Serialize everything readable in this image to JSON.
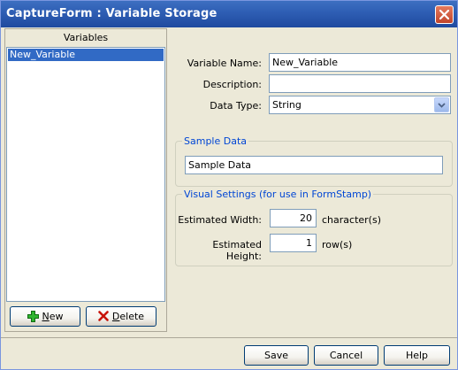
{
  "window": {
    "title": "CaptureForm : Variable Storage"
  },
  "variables_panel": {
    "header": "Variables",
    "items": [
      "New_Variable"
    ],
    "new_button": {
      "prefix": "",
      "mnemonic": "N",
      "suffix": "ew"
    },
    "delete_button": {
      "prefix": "",
      "mnemonic": "D",
      "suffix": "elete"
    }
  },
  "form": {
    "variable_name_label": "Variable Name:",
    "variable_name_value": "New_Variable",
    "description_label": "Description:",
    "description_value": "",
    "data_type_label": "Data Type:",
    "data_type_value": "String"
  },
  "sample_data": {
    "group_title": "Sample Data",
    "value": "Sample Data"
  },
  "visual_settings": {
    "group_title": "Visual Settings (for use in FormStamp)",
    "width_label": "Estimated Width:",
    "width_value": "20",
    "width_unit": "character(s)",
    "height_label": "Estimated Height:",
    "height_value": "1",
    "height_unit": "row(s)"
  },
  "footer": {
    "save_label": "Save",
    "cancel_label": "Cancel",
    "help_label": "Help"
  },
  "colors": {
    "titlebar": "#2f5fb5",
    "selection": "#316ac5",
    "group_title": "#0046d5",
    "dialog_bg": "#ece9d8"
  }
}
